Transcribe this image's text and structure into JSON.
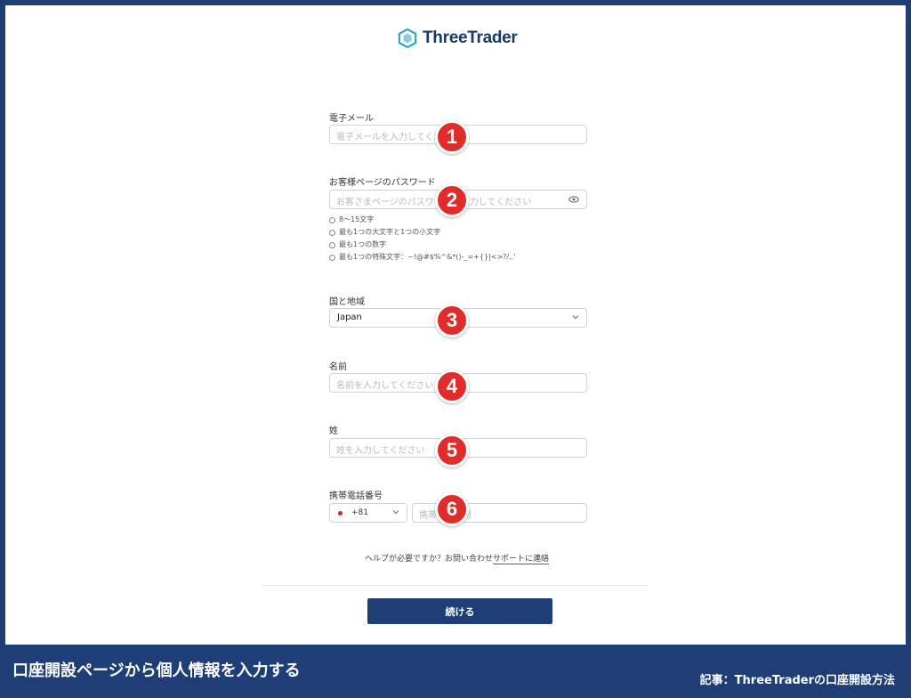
{
  "brand": {
    "name": "ThreeTrader"
  },
  "form": {
    "email": {
      "label": "電子メール",
      "placeholder": "電子メールを入力してください"
    },
    "password": {
      "label": "お客様ページのパスワード",
      "placeholder": "お客さまページのパスワードを入力してください",
      "rules": [
        "8～15文字",
        "最も1つの大文字と1つの小文字",
        "最も1つの数字",
        "最も1つの特殊文字：~!@#$%^&*()-_=+{}|<>?/,.'"
      ]
    },
    "country": {
      "label": "国と地域",
      "value": "Japan"
    },
    "first_name": {
      "label": "名前",
      "placeholder": "名前を入力してください"
    },
    "last_name": {
      "label": "姓",
      "placeholder": "姓を入力してください"
    },
    "phone": {
      "label": "携帯電話番号",
      "country_code": "+81",
      "placeholder": "携帯電話番号"
    }
  },
  "help": {
    "prefix": "ヘルプが必要ですか？お問い合わせ",
    "link": "サポートに連絡"
  },
  "continue_label": "続ける",
  "badges": [
    "1",
    "2",
    "3",
    "4",
    "5",
    "6"
  ],
  "caption": "口座開設ページから個人情報を入力する",
  "article": "記事：ThreeTraderの口座開設方法",
  "colors": {
    "frame": "#1f3e78",
    "badge": "#e12c2c",
    "button": "#1f3e78",
    "logo_accent": "#2aa6c9"
  }
}
